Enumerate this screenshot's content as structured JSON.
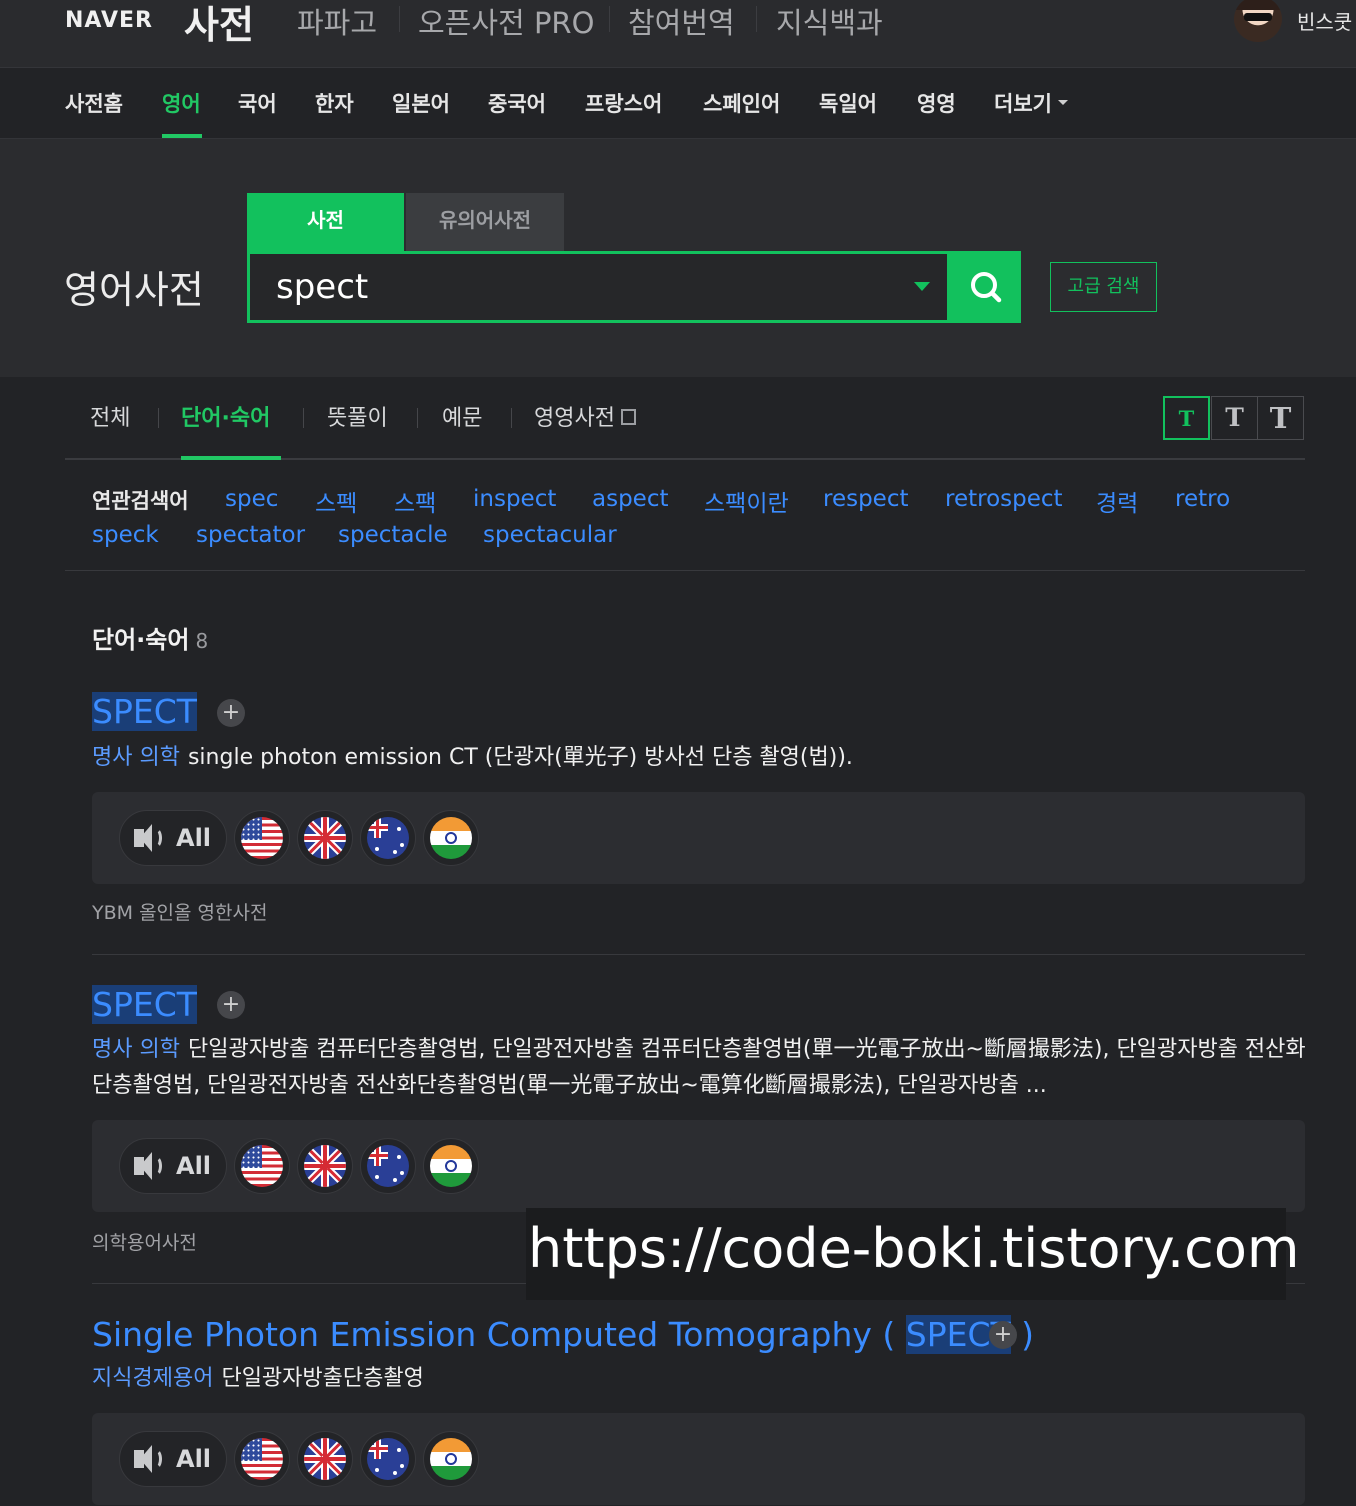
{
  "header": {
    "brand": "NAVER",
    "app_title": "사전",
    "services": [
      "파파고",
      "오픈사전 PRO",
      "참여번역",
      "지식백과"
    ],
    "username": "빈스쿳"
  },
  "lang_nav": [
    "사전홈",
    "영어",
    "국어",
    "한자",
    "일본어",
    "중국어",
    "프랑스어",
    "스페인어",
    "독일어",
    "영영",
    "더보기"
  ],
  "lang_nav_active": "영어",
  "search": {
    "page_title": "영어사전",
    "tab_dict": "사전",
    "tab_synonym": "유의어사전",
    "query": "spect",
    "advanced_label": "고급 검색"
  },
  "result_tabs": {
    "all": "전체",
    "words": "단어·숙어",
    "meanings": "뜻풀이",
    "examples": "예문",
    "eng_eng": "영영사전"
  },
  "text_size_buttons": [
    "T",
    "T",
    "T"
  ],
  "related": {
    "label": "연관검색어",
    "items": [
      "spec",
      "스펙",
      "스팩",
      "inspect",
      "aspect",
      "스팩이란",
      "respect",
      "retrospect",
      "경력",
      "retro",
      "speck",
      "spectator",
      "spectacle",
      "spectacular"
    ]
  },
  "section": {
    "title": "단어·숙어",
    "count": "8"
  },
  "entries": [
    {
      "word": "SPECT",
      "pos": "명사  의학",
      "meaning": "single photon emission CT (단광자(單光子) 방사선 단층 촬영(법)).",
      "source": "YBM 올인올 영한사전"
    },
    {
      "word": "SPECT",
      "pos": "명사  의학",
      "meaning": "단일광자방출 컴퓨터단층촬영법, 단일광전자방출 컴퓨터단층촬영법(單一光電子放出~斷層撮影法), 단일광자방출 전산화단층촬영법, 단일광전자방출 전산화단층촬영법(單一光電子放出~電算化斷層撮影法), 단일광자방출 ...",
      "source": "의학용어사전"
    },
    {
      "word_prefix": "Single Photon Emission Computed Tomography ( ",
      "word_hl": "SPECT",
      "word_suffix": " )",
      "pos": "지식경제용어",
      "meaning": "단일광자방출단층촬영"
    }
  ],
  "pronunciation": {
    "all_label": "All",
    "flags": [
      "us-flag-icon",
      "uk-flag-icon",
      "au-flag-icon",
      "in-flag-icon"
    ]
  },
  "watermark": "https://code-boki.tistory.com",
  "colors": {
    "accent_green": "#12c15d",
    "link_blue": "#3b8cff",
    "background": "#222326"
  }
}
